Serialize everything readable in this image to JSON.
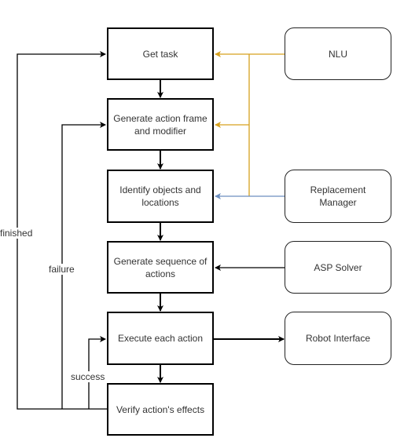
{
  "diagram": {
    "type": "flowchart",
    "main_steps": [
      {
        "id": "get-task",
        "label": "Get task"
      },
      {
        "id": "generate-action-frame",
        "label": "Generate action frame and modifier"
      },
      {
        "id": "identify-objects",
        "label": "Identify objects and locations"
      },
      {
        "id": "generate-sequence",
        "label": "Generate sequence of actions"
      },
      {
        "id": "execute-action",
        "label": "Execute each action"
      },
      {
        "id": "verify-effects",
        "label": "Verify action's effects"
      }
    ],
    "modules": [
      {
        "id": "nlu",
        "label": "NLU"
      },
      {
        "id": "replacement-manager",
        "label": "Replacement Manager"
      },
      {
        "id": "asp-solver",
        "label": "ASP Solver"
      },
      {
        "id": "robot-interface",
        "label": "Robot Interface"
      }
    ],
    "edge_labels": {
      "finished": "finished",
      "failure": "failure",
      "success": "success"
    },
    "edges": [
      {
        "from": "get-task",
        "to": "generate-action-frame",
        "color": "#000000"
      },
      {
        "from": "generate-action-frame",
        "to": "identify-objects",
        "color": "#000000"
      },
      {
        "from": "identify-objects",
        "to": "generate-sequence",
        "color": "#000000"
      },
      {
        "from": "generate-sequence",
        "to": "execute-action",
        "color": "#000000"
      },
      {
        "from": "execute-action",
        "to": "verify-effects",
        "color": "#000000"
      },
      {
        "from": "nlu",
        "to": "get-task",
        "color": "#d6a01e"
      },
      {
        "from": "nlu",
        "to": "generate-action-frame",
        "color": "#d6a01e"
      },
      {
        "from": "replacement-manager",
        "to": "identify-objects",
        "color": "#6c8ebf"
      },
      {
        "from": "asp-solver",
        "to": "generate-sequence",
        "color": "#000000"
      },
      {
        "from": "execute-action",
        "to": "robot-interface",
        "color": "#000000"
      },
      {
        "from": "verify-effects",
        "to": "get-task",
        "label": "finished",
        "color": "#000000"
      },
      {
        "from": "verify-effects",
        "to": "generate-action-frame",
        "label": "failure",
        "color": "#000000"
      },
      {
        "from": "verify-effects",
        "to": "execute-action",
        "label": "success",
        "color": "#000000"
      }
    ]
  },
  "colors": {
    "nlu_link": "#d6a01e",
    "replacement_link": "#6c8ebf",
    "default_link": "#000000"
  }
}
